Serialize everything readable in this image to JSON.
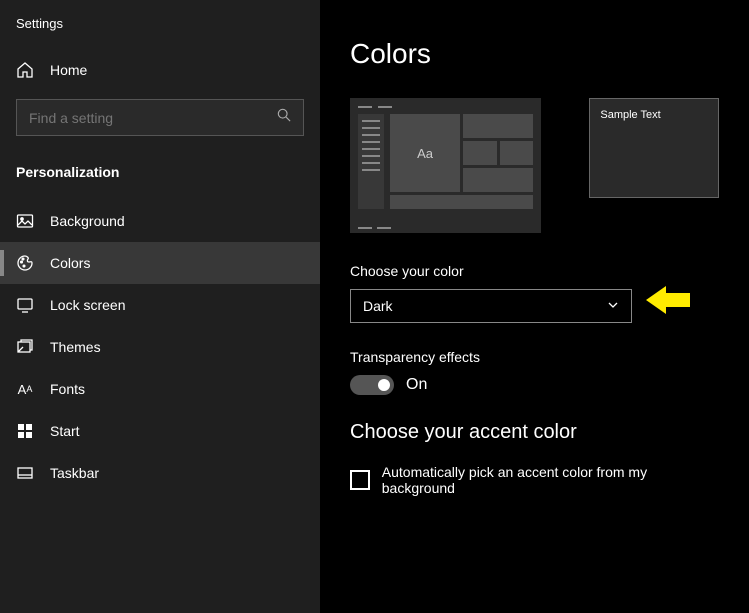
{
  "app": {
    "title": "Settings"
  },
  "search": {
    "placeholder": "Find a setting"
  },
  "nav": {
    "home": "Home",
    "section": "Personalization",
    "items": [
      {
        "label": "Background"
      },
      {
        "label": "Colors"
      },
      {
        "label": "Lock screen"
      },
      {
        "label": "Themes"
      },
      {
        "label": "Fonts"
      },
      {
        "label": "Start"
      },
      {
        "label": "Taskbar"
      }
    ]
  },
  "page": {
    "title": "Colors",
    "preview": {
      "sample_text": "Sample Text",
      "aa": "Aa"
    },
    "color_mode": {
      "label": "Choose your color",
      "value": "Dark"
    },
    "transparency": {
      "label": "Transparency effects",
      "state": "On"
    },
    "accent": {
      "title": "Choose your accent color",
      "auto_label": "Automatically pick an accent color from my background"
    }
  }
}
